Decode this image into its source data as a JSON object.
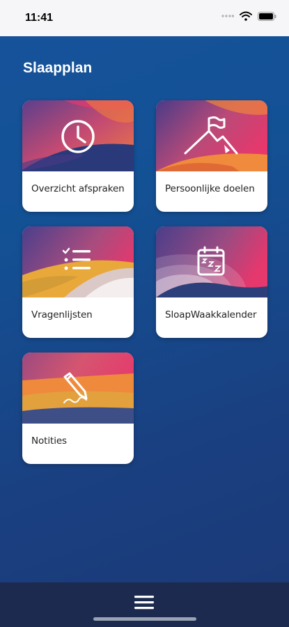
{
  "status_bar": {
    "time": "11:41",
    "icons": [
      "signal-dots-icon",
      "wifi-icon",
      "battery-icon"
    ]
  },
  "page": {
    "title": "Slaapplan"
  },
  "cards": [
    {
      "label": "Overzicht afspraken",
      "icon": "clock-icon"
    },
    {
      "label": "Persoonlijke doelen",
      "icon": "mountain-flag-icon"
    },
    {
      "label": "Vragenlijsten",
      "icon": "checklist-icon"
    },
    {
      "label": "SloapWaakkalender",
      "icon": "calendar-sleep-icon"
    },
    {
      "label": "Notities",
      "icon": "pen-icon"
    }
  ],
  "bottom_bar": {
    "menu_icon": "hamburger-menu-icon"
  },
  "colors": {
    "background": "#16529a",
    "card_gradient_start": "#e0366e",
    "card_gradient_mid": "#f08a3c",
    "card_dark": "#2b3e7a",
    "bottom_bar": "#1b2a4e"
  }
}
